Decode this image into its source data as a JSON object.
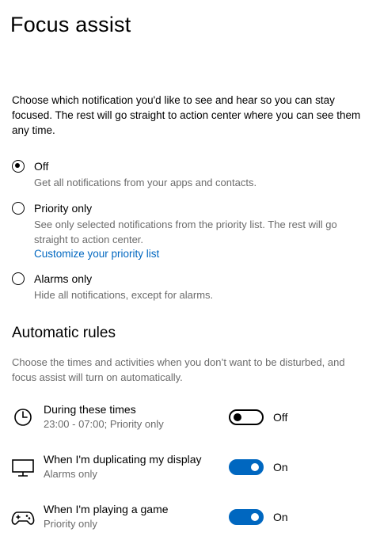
{
  "page": {
    "title": "Focus assist",
    "intro": "Choose which notification you'd like to see and hear so you can stay focused. The rest will go straight to action center where you can see them any time."
  },
  "options": [
    {
      "label": "Off",
      "description": "Get all notifications from your apps and contacts.",
      "selected": true
    },
    {
      "label": "Priority only",
      "description": "See only selected notifications from the priority list. The rest will go straight to action center.",
      "link": "Customize your priority list",
      "selected": false
    },
    {
      "label": "Alarms only",
      "description": "Hide all notifications, except for alarms.",
      "selected": false
    }
  ],
  "automatic_rules": {
    "title": "Automatic rules",
    "description": "Choose the times and activities when you don’t want to be disturbed, and focus assist will turn on automatically.",
    "rules": [
      {
        "icon": "clock-icon",
        "title": "During these times",
        "subtitle": "23:00 - 07:00; Priority only",
        "enabled": false,
        "state_label": "Off"
      },
      {
        "icon": "monitor-icon",
        "title": "When I'm duplicating my display",
        "subtitle": "Alarms only",
        "enabled": true,
        "state_label": "On"
      },
      {
        "icon": "gamepad-icon",
        "title": "When I'm playing a game",
        "subtitle": "Priority only",
        "enabled": true,
        "state_label": "On"
      }
    ]
  },
  "colors": {
    "accent": "#0067c0",
    "secondary_text": "#6b6b6b"
  }
}
